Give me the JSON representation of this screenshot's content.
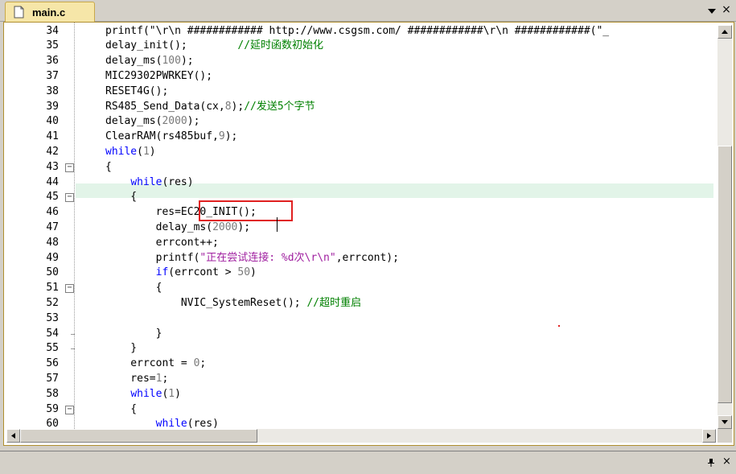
{
  "tab": {
    "label": "main.c",
    "close_glyph": "×",
    "icon": "file-icon"
  },
  "editor": {
    "current_line": 46,
    "lines": [
      {
        "no": "34",
        "fold": "",
        "html_key": "l34"
      },
      {
        "no": "35",
        "fold": "",
        "html_key": "l35"
      },
      {
        "no": "36",
        "fold": "",
        "html_key": "l36"
      },
      {
        "no": "37",
        "fold": "",
        "html_key": "l37"
      },
      {
        "no": "38",
        "fold": "",
        "html_key": "l38"
      },
      {
        "no": "39",
        "fold": "",
        "html_key": "l39"
      },
      {
        "no": "40",
        "fold": "",
        "html_key": "l40"
      },
      {
        "no": "41",
        "fold": "",
        "html_key": "l41"
      },
      {
        "no": "42",
        "fold": "",
        "html_key": "l42"
      },
      {
        "no": "43",
        "fold": "box",
        "html_key": "l43"
      },
      {
        "no": "44",
        "fold": "",
        "html_key": "l44"
      },
      {
        "no": "45",
        "fold": "box",
        "html_key": "l45"
      },
      {
        "no": "46",
        "fold": "",
        "html_key": "l46"
      },
      {
        "no": "47",
        "fold": "",
        "html_key": "l47"
      },
      {
        "no": "48",
        "fold": "",
        "html_key": "l48"
      },
      {
        "no": "49",
        "fold": "",
        "html_key": "l49"
      },
      {
        "no": "50",
        "fold": "",
        "html_key": "l50"
      },
      {
        "no": "51",
        "fold": "box",
        "html_key": "l51"
      },
      {
        "no": "52",
        "fold": "",
        "html_key": "l52"
      },
      {
        "no": "53",
        "fold": "",
        "html_key": "l53"
      },
      {
        "no": "54",
        "fold": "tick",
        "html_key": "l54"
      },
      {
        "no": "55",
        "fold": "tick",
        "html_key": "l55"
      },
      {
        "no": "56",
        "fold": "",
        "html_key": "l56"
      },
      {
        "no": "57",
        "fold": "",
        "html_key": "l57"
      },
      {
        "no": "58",
        "fold": "",
        "html_key": "l58"
      },
      {
        "no": "59",
        "fold": "box",
        "html_key": "l59"
      },
      {
        "no": "60",
        "fold": "",
        "html_key": "l60"
      }
    ],
    "code": {
      "l34": [
        [
          "",
          "printf(\"\\r\\n ############ http://www.csgsm.com/ ############\\r\\n ############(\"_"
        ]
      ],
      "l35": [
        [
          "",
          "delay_init();        "
        ],
        [
          "cm",
          "//延时函数初始化"
        ]
      ],
      "l36": [
        [
          "",
          "delay_ms("
        ],
        [
          "num",
          "100"
        ],
        [
          "",
          ");"
        ]
      ],
      "l37": [
        [
          "",
          "MIC29302PWRKEY();"
        ]
      ],
      "l38": [
        [
          "",
          "RESET4G();"
        ]
      ],
      "l39": [
        [
          "",
          "RS485_Send_Data(cx,"
        ],
        [
          "num",
          "8"
        ],
        [
          "",
          ");"
        ],
        [
          "cm",
          "//发送5个字节"
        ]
      ],
      "l40": [
        [
          "",
          "delay_ms("
        ],
        [
          "num",
          "2000"
        ],
        [
          "",
          ");"
        ]
      ],
      "l41": [
        [
          "",
          "ClearRAM(rs485buf,"
        ],
        [
          "num",
          "9"
        ],
        [
          "",
          ");"
        ]
      ],
      "l42": [
        [
          "kw",
          "while"
        ],
        [
          "",
          "("
        ],
        [
          "num",
          "1"
        ],
        [
          "",
          ")"
        ]
      ],
      "l43": [
        [
          "",
          "{"
        ]
      ],
      "l44": [
        [
          "",
          "    "
        ],
        [
          "kw",
          "while"
        ],
        [
          "",
          "(res)"
        ]
      ],
      "l45": [
        [
          "",
          "    {"
        ]
      ],
      "l46": [
        [
          "",
          "        res=EC20_INIT();"
        ]
      ],
      "l47": [
        [
          "",
          "        delay_ms("
        ],
        [
          "num",
          "2000"
        ],
        [
          "",
          ");"
        ]
      ],
      "l48": [
        [
          "",
          "        errcont++;"
        ]
      ],
      "l49": [
        [
          "",
          "        printf("
        ],
        [
          "str",
          "\"正在尝试连接: %d次\\r\\n\""
        ],
        [
          "",
          ",errcont);"
        ]
      ],
      "l50": [
        [
          "",
          "        "
        ],
        [
          "kw",
          "if"
        ],
        [
          "",
          "(errcont > "
        ],
        [
          "num",
          "50"
        ],
        [
          "",
          ")"
        ]
      ],
      "l51": [
        [
          "",
          "        {"
        ]
      ],
      "l52": [
        [
          "",
          "            NVIC_SystemReset(); "
        ],
        [
          "cm",
          "//超时重启"
        ]
      ],
      "l53": [
        [
          "",
          ""
        ]
      ],
      "l54": [
        [
          "",
          "        }"
        ]
      ],
      "l55": [
        [
          "",
          "    }"
        ]
      ],
      "l56": [
        [
          "",
          "    errcont = "
        ],
        [
          "num",
          "0"
        ],
        [
          "",
          ";"
        ]
      ],
      "l57": [
        [
          "",
          "    res="
        ],
        [
          "num",
          "1"
        ],
        [
          "",
          ";"
        ]
      ],
      "l58": [
        [
          "",
          "    "
        ],
        [
          "kw",
          "while"
        ],
        [
          "",
          "("
        ],
        [
          "num",
          "1"
        ],
        [
          "",
          ")"
        ]
      ],
      "l59": [
        [
          "",
          "    {"
        ]
      ],
      "l60": [
        [
          "",
          "        "
        ],
        [
          "kw",
          "while"
        ],
        [
          "",
          "(res)"
        ]
      ]
    }
  },
  "colors": {
    "keyword": "#0000ff",
    "number": "#7a7a7a",
    "string": "#a020a0",
    "comment": "#008000",
    "current_line_bg": "#e2f4e8",
    "annotation_box": "#e02020"
  },
  "bottom_panel": {
    "pin_glyph": "📌",
    "close_glyph": "×"
  }
}
